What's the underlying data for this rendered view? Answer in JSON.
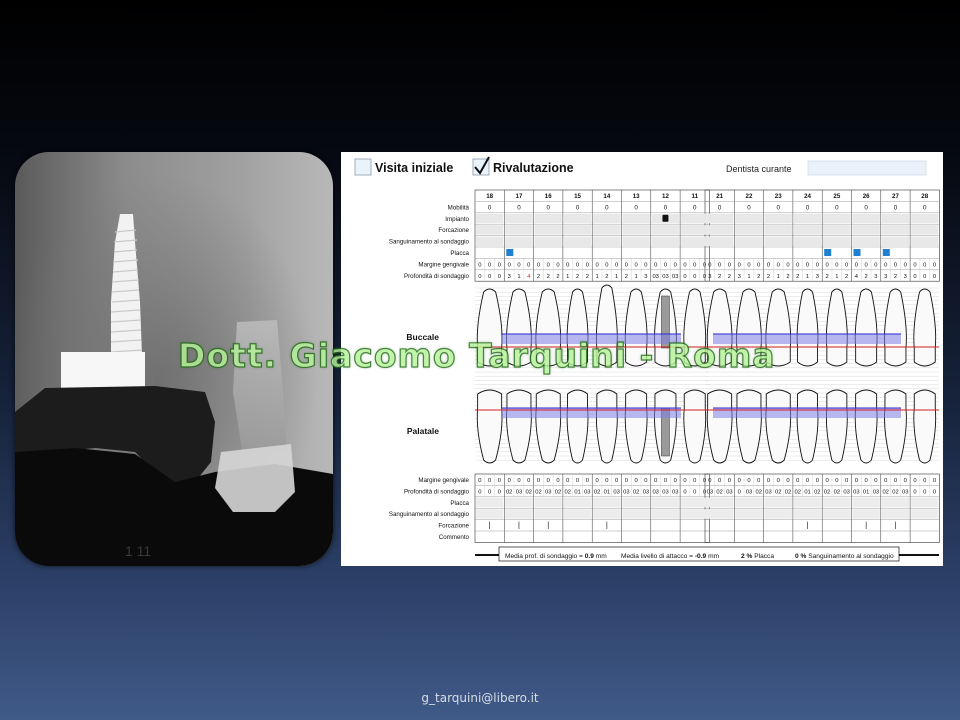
{
  "slide": {
    "watermark": "Dott. Giacomo Tarquini - Roma",
    "footer_email": "g_tarquini@libero.it"
  },
  "radiograph": {
    "caption": "1 11"
  },
  "chart": {
    "header": {
      "visita_iniziale": "Visita iniziale",
      "rivalutazione": "Rivalutazione",
      "visita_iniziale_checked": false,
      "rivalutazione_checked": true,
      "dentista_curante": "Dentista curante",
      "dentista_value": ""
    },
    "upper_teeth_right": [
      "18",
      "17",
      "16",
      "15",
      "14",
      "13",
      "12",
      "11"
    ],
    "upper_teeth_left": [
      "21",
      "22",
      "23",
      "24",
      "25",
      "26",
      "27",
      "28"
    ],
    "upper_labels": [
      "Mobilità",
      "Impianto",
      "Forcazione",
      "Sanguinamento al sondaggio",
      "Placca",
      "Margine gengivale",
      "Profondità di sondaggio"
    ],
    "mobility_right": [
      "0",
      "0",
      "0",
      "0",
      "0",
      "0",
      "0",
      "0"
    ],
    "mobility_left": [
      "0",
      "0",
      "0",
      "0",
      "0",
      "0",
      "0",
      "0"
    ],
    "implant_tooth": "12",
    "plaque_upper_right_teeth": [
      "17"
    ],
    "plaque_upper_left_teeth": [
      "25",
      "26",
      "27"
    ],
    "upper_margin_right": [
      "0 0 0",
      "0 0 0",
      "0 0 0",
      "0 0 0",
      "0 0 0",
      "0 0 0",
      "0 0 0",
      "0 0 0"
    ],
    "upper_margin_left": [
      "0 0 0",
      "0 0 0",
      "0 0 0",
      "0 0 0",
      "0 0 0",
      "0 0 0",
      "0 0 0",
      "0 0 0"
    ],
    "upper_probing_right": [
      "0 0 0",
      "3 1 4",
      "2 2 2",
      "1 2 2",
      "1 2 1",
      "2 1 3",
      "03 03 03",
      "0 0 0"
    ],
    "upper_probing_left": [
      "3 2 2",
      "3 1 2",
      "2 1 2",
      "2 1 3",
      "2 1 2",
      "4 2 3",
      "3 2 3",
      "0 0 0"
    ],
    "upper_probing_red": [
      "17:4",
      "26:4"
    ],
    "section_labels": {
      "buccal": "Buccale",
      "palatal": "Palatale"
    },
    "lower_labels": [
      "Margine gengivale",
      "Profondità di sondaggio",
      "Placca",
      "Sanguinamento al sondaggio",
      "Forcazione",
      "Commento"
    ],
    "lower_margin_right": [
      "0 0 0",
      "0 0 0",
      "0 0 0",
      "0 0 0",
      "0 0 0",
      "0 0 0",
      "0 0 0",
      "0 0 0"
    ],
    "lower_margin_left": [
      "0 0 0",
      "0 0 0",
      "0 0 0",
      "0 0 0",
      "0 0 0",
      "0 0 0",
      "0 0 0",
      "0 0 0"
    ],
    "lower_probing_right": [
      "0 0 0",
      "02 03 02",
      "02 03 02",
      "02 01 03",
      "02 01 03",
      "03 02 03",
      "03 03 03",
      "0 0 0"
    ],
    "lower_probing_left": [
      "03 02 03",
      "0 03 02",
      "03 02 02",
      "02 01 02",
      "02 02 03",
      "03 01 03",
      "02 02 03",
      "0 0 0"
    ],
    "summary": {
      "probing_label": "Media prof. di sondaggio =",
      "probing_value": "0.9",
      "probing_unit": "mm",
      "attachment_label": "Media livello di attacco =",
      "attachment_value": "-0.9",
      "attachment_unit": "mm",
      "plaque_value": "2 %",
      "plaque_label": "Placca",
      "bleeding_value": "0 %",
      "bleeding_label": "Sanguinamento al sondaggio"
    },
    "colors": {
      "plaque": "#1f7fd0",
      "implant": "#111111",
      "gingival_line": "#2a2ad0",
      "band_fill": "#7f7fe8",
      "cej_line": "#d02020",
      "red_value": "#d22020"
    }
  }
}
